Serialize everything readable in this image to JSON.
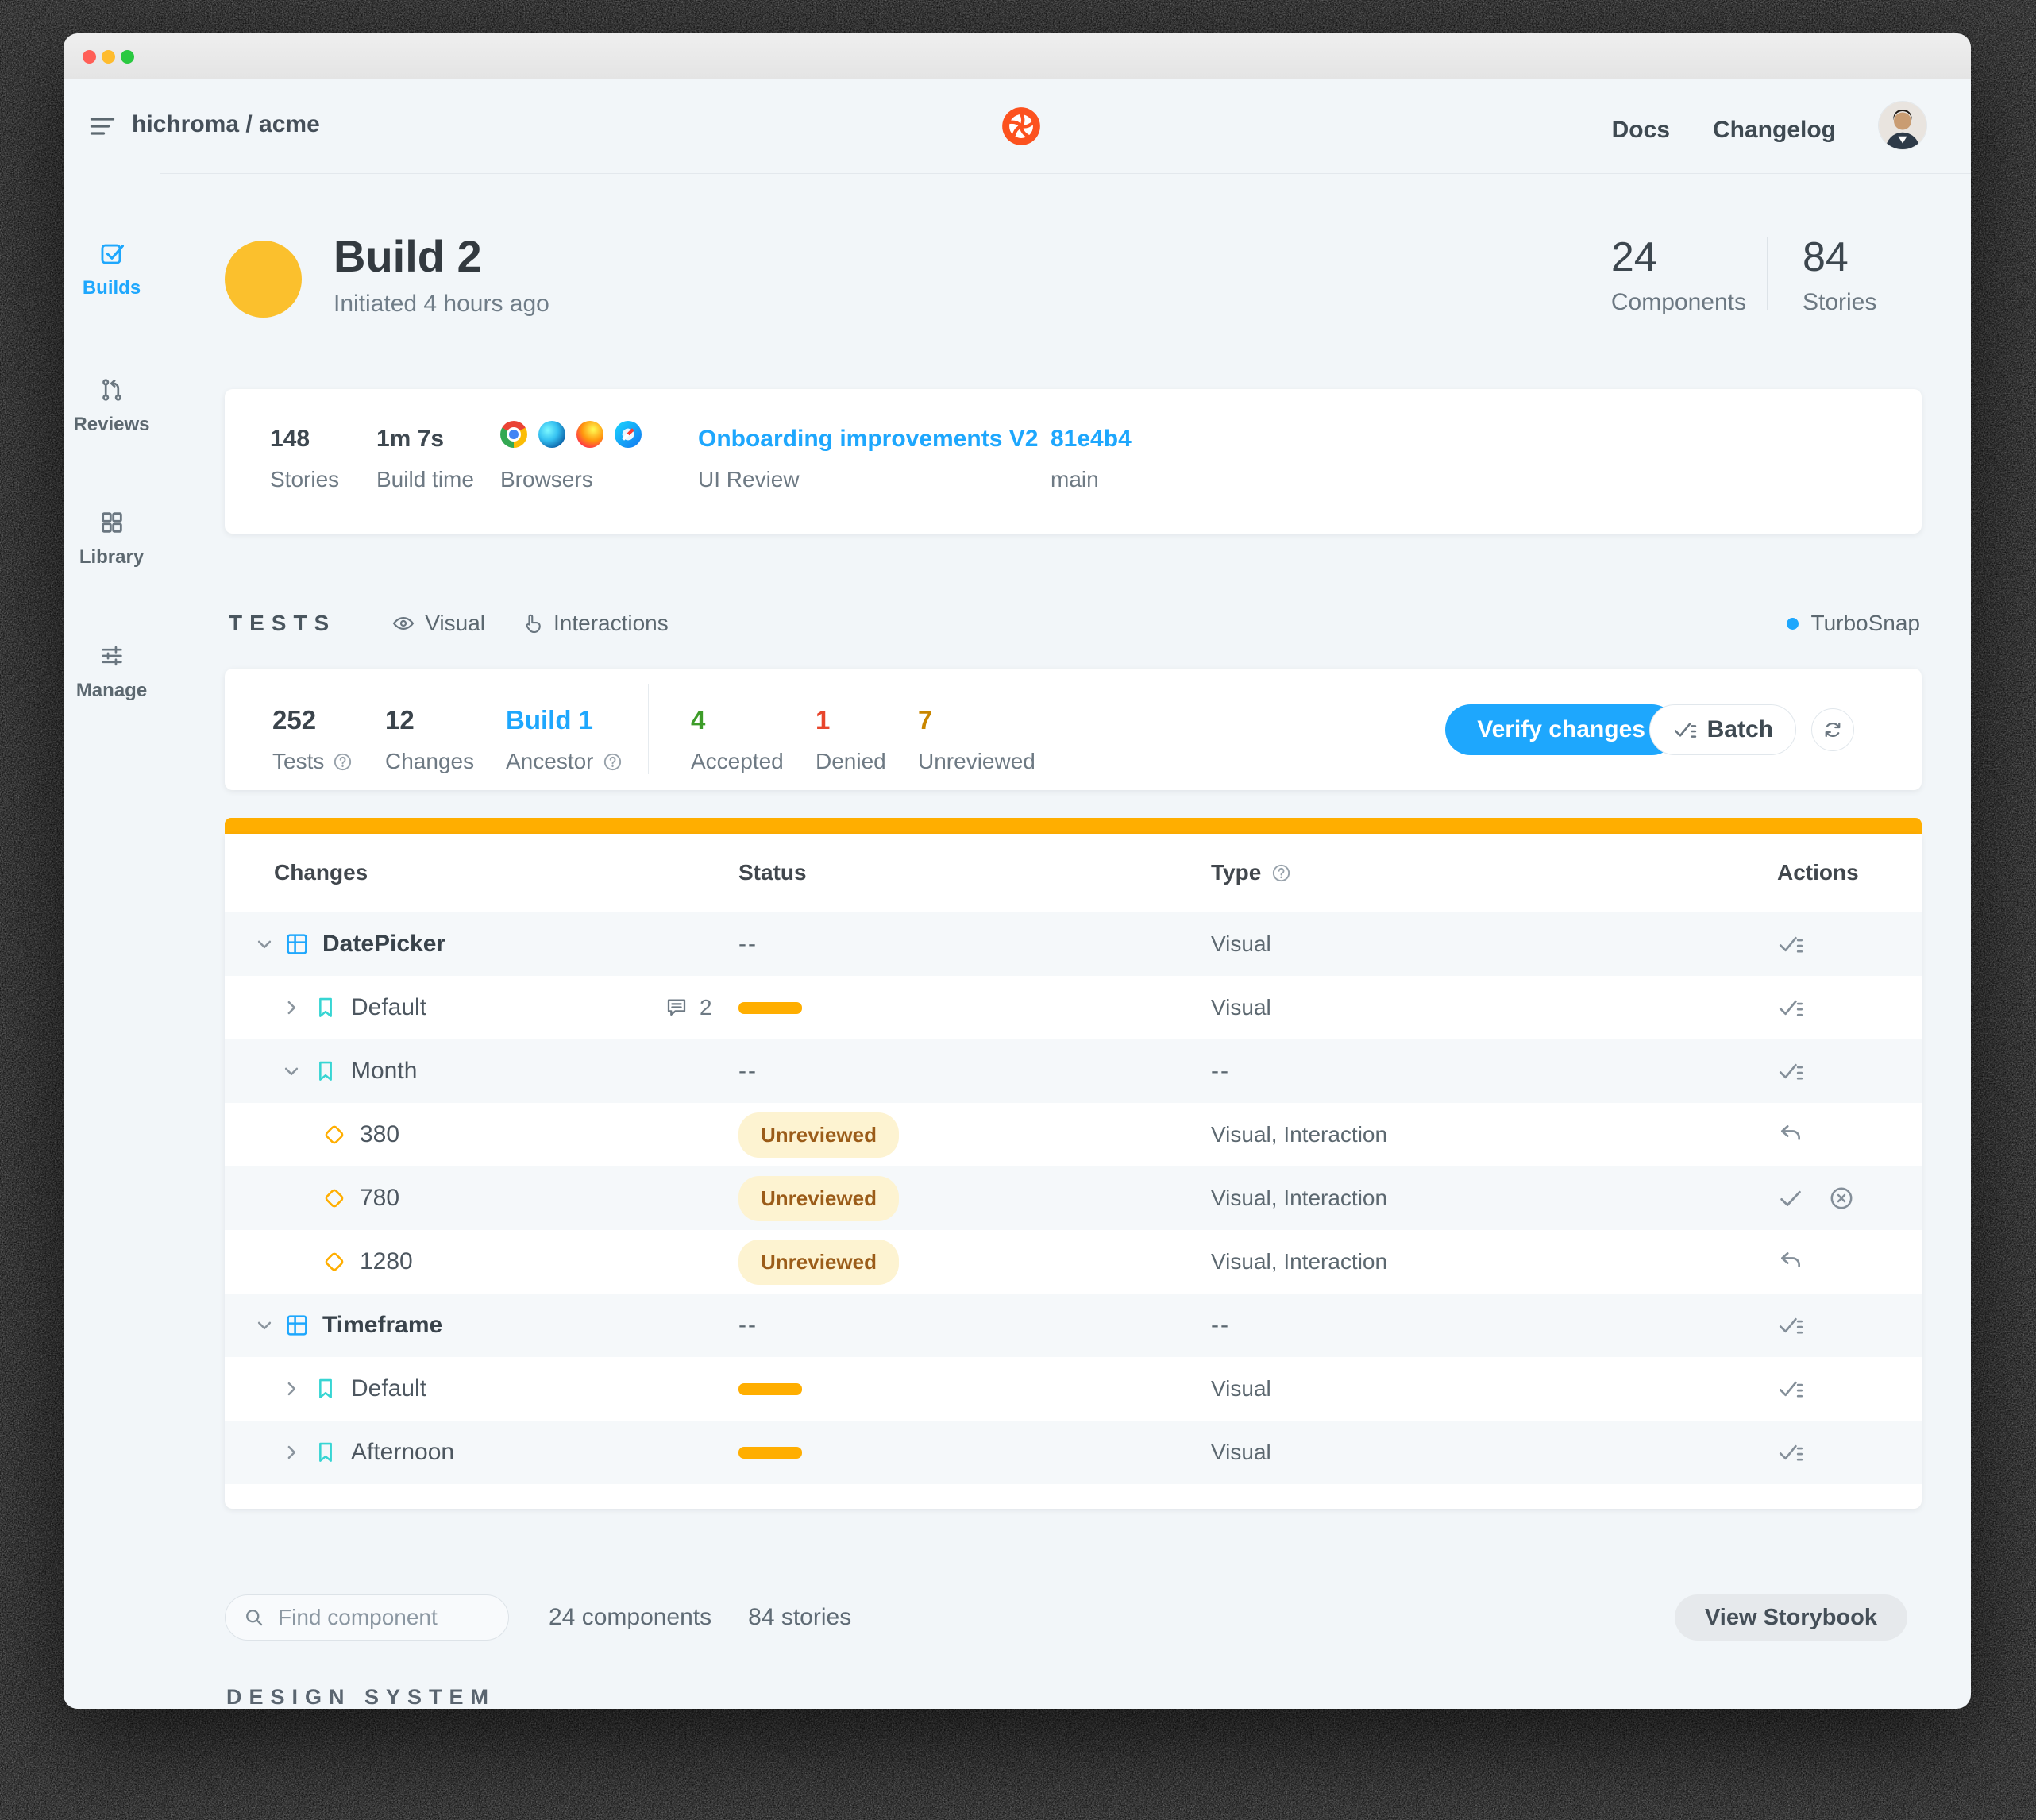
{
  "chrome": {
    "org": "hichroma / acme",
    "docs": "Docs",
    "changelog": "Changelog"
  },
  "sidebar": {
    "items": [
      {
        "label": "Builds",
        "active": true
      },
      {
        "label": "Reviews",
        "active": false
      },
      {
        "label": "Library",
        "active": false
      },
      {
        "label": "Manage",
        "active": false
      }
    ]
  },
  "build": {
    "title": "Build 2",
    "subtitle": "Initiated 4 hours ago",
    "components_value": "24",
    "components_label": "Components",
    "stories_value": "84",
    "stories_label": "Stories"
  },
  "info": {
    "stories_value": "148",
    "stories_label": "Stories",
    "time_value": "1m 7s",
    "time_label": "Build time",
    "browsers_label": "Browsers",
    "browsers": [
      "Chrome",
      "Edge",
      "Firefox",
      "Safari"
    ],
    "review_title": "Onboarding improvements V2",
    "review_label": "UI Review",
    "commit": "81e4b4",
    "branch": "main"
  },
  "tests": {
    "heading": "TESTS",
    "visual": "Visual",
    "interactions": "Interactions",
    "turbosnap": "TurboSnap"
  },
  "summary": {
    "tests_value": "252",
    "tests_label": "Tests",
    "changes_value": "12",
    "changes_label": "Changes",
    "ancestor_value": "Build 1",
    "ancestor_label": "Ancestor",
    "accepted_value": "4",
    "accepted_label": "Accepted",
    "denied_value": "1",
    "denied_label": "Denied",
    "unreviewed_value": "7",
    "unreviewed_label": "Unreviewed",
    "verify": "Verify changes",
    "batch": "Batch"
  },
  "table": {
    "columns": [
      "Changes",
      "Status",
      "Type",
      "Actions"
    ],
    "rows": [
      {
        "level": 0,
        "chevron": "down",
        "icon": "component",
        "label": "DatePicker",
        "status": {
          "kind": "dash"
        },
        "type": "Visual",
        "actions": [
          "batch"
        ],
        "shaded": true
      },
      {
        "level": 1,
        "chevron": "right",
        "icon": "bookmark",
        "label": "Default",
        "status": {
          "kind": "progress",
          "comments": "2"
        },
        "type": "Visual",
        "actions": [
          "batch"
        ],
        "shaded": false
      },
      {
        "level": 1,
        "chevron": "down",
        "icon": "bookmark",
        "label": "Month",
        "status": {
          "kind": "dash"
        },
        "type": "--",
        "actions": [
          "batch"
        ],
        "shaded": true
      },
      {
        "level": 2,
        "chevron": null,
        "icon": "diamond",
        "label": "380",
        "status": {
          "kind": "badge",
          "text": "Unreviewed"
        },
        "type": "Visual, Interaction",
        "actions": [
          "undo"
        ],
        "shaded": false
      },
      {
        "level": 2,
        "chevron": null,
        "icon": "diamond",
        "label": "780",
        "status": {
          "kind": "badge",
          "text": "Unreviewed"
        },
        "type": "Visual, Interaction",
        "actions": [
          "check",
          "deny"
        ],
        "shaded": true
      },
      {
        "level": 2,
        "chevron": null,
        "icon": "diamond",
        "label": "1280",
        "status": {
          "kind": "badge",
          "text": "Unreviewed"
        },
        "type": "Visual, Interaction",
        "actions": [
          "undo"
        ],
        "shaded": false
      },
      {
        "level": 0,
        "chevron": "down",
        "icon": "component",
        "label": "Timeframe",
        "status": {
          "kind": "dash"
        },
        "type": "--",
        "actions": [
          "batch"
        ],
        "shaded": true
      },
      {
        "level": 1,
        "chevron": "right",
        "icon": "bookmark",
        "label": "Default",
        "status": {
          "kind": "progress"
        },
        "type": "Visual",
        "actions": [
          "batch"
        ],
        "shaded": false
      },
      {
        "level": 1,
        "chevron": "right",
        "icon": "bookmark",
        "label": "Afternoon",
        "status": {
          "kind": "progress"
        },
        "type": "Visual",
        "actions": [
          "batch"
        ],
        "shaded": true
      }
    ]
  },
  "footer": {
    "search_placeholder": "Find component",
    "components": "24 components",
    "stories": "84 stories",
    "view_storybook": "View Storybook",
    "heading": "DESIGN SYSTEM"
  },
  "colors": {
    "accent_blue": "#1ea7fd",
    "progress_orange": "#ffae00",
    "accepted_green": "#3d9c29",
    "denied_red": "#e8452c",
    "unreviewed_amber": "#c98600",
    "brand_orange": "#fc521f",
    "bookmark_teal": "#37d5d3",
    "badge_bg": "#fdf3d1"
  }
}
